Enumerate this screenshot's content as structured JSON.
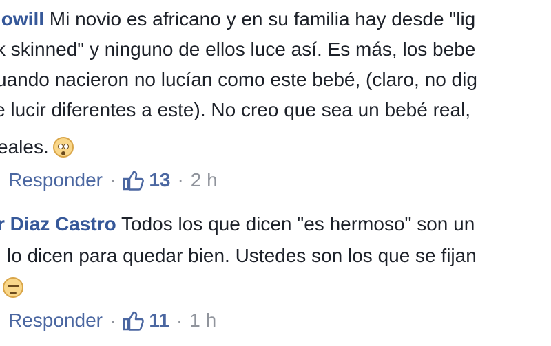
{
  "comments": [
    {
      "author": "lowill",
      "lines": [
        "Mi novio es africano y en su familia hay desde \"lig",
        "k skinned\" y ninguno de ellos luce así. Es más, los bebe",
        "uando nacieron no lucían como este bebé, (claro, no dig",
        "e lucir diferentes a este). No creo que sea un bebé real,",
        "eales."
      ],
      "emoji": "flushed-face-icon",
      "reply_label": "Responder",
      "separator": "·",
      "likes": "13",
      "time": "2 h"
    },
    {
      "author": "r Diaz Castro",
      "lines": [
        "Todos los que dicen \"es hermoso\" son un",
        "lo dicen para quedar bien. Ustedes son los que se fijan"
      ],
      "emoji": "unamused-face-icon",
      "reply_label": "Responder",
      "separator": "·",
      "likes": "11",
      "time": "1 h"
    }
  ],
  "colors": {
    "author": "#365899",
    "text": "#1d2129",
    "link": "#4b67a1",
    "meta": "#90949c"
  }
}
